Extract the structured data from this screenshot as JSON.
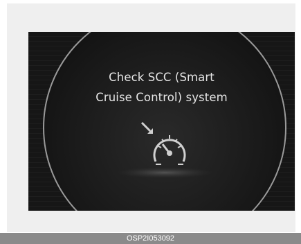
{
  "display": {
    "message_line1": "Check SCC (Smart",
    "message_line2": "Cruise Control) system",
    "icon": "scc-warning-gauge-icon",
    "indicator_color": "#d0d0d0"
  },
  "caption": {
    "code": "OSP2I053092"
  }
}
